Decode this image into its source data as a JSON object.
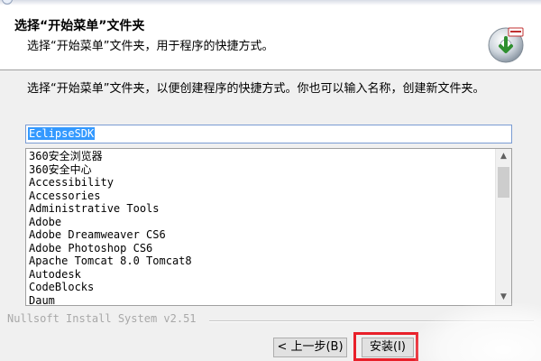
{
  "header": {
    "title": "选择“开始菜单”文件夹",
    "subtitle": "选择“开始菜单”文件夹，用于程序的快捷方式。",
    "icon": "installer-disc-icon"
  },
  "instruction": "选择“开始菜单”文件夹，以便创建程序的快捷方式。你也可以输入名称，创建新文件夹。",
  "folder_input": {
    "value": "EclipseSDK"
  },
  "folder_list": {
    "items": [
      "360安全浏览器",
      "360安全中心",
      "Accessibility",
      "Accessories",
      "Administrative Tools",
      "Adobe",
      "Adobe Dreamweaver CS6",
      "Adobe Photoshop CS6",
      "Apache Tomcat 8.0 Tomcat8",
      "Autodesk",
      "CodeBlocks",
      "Daum"
    ]
  },
  "branding": "Nullsoft Install System v2.51",
  "buttons": {
    "back": "< 上一步(B)",
    "install": "安装(I)"
  },
  "colors": {
    "selection": "#3399ff",
    "highlight_box": "#e8202a"
  }
}
